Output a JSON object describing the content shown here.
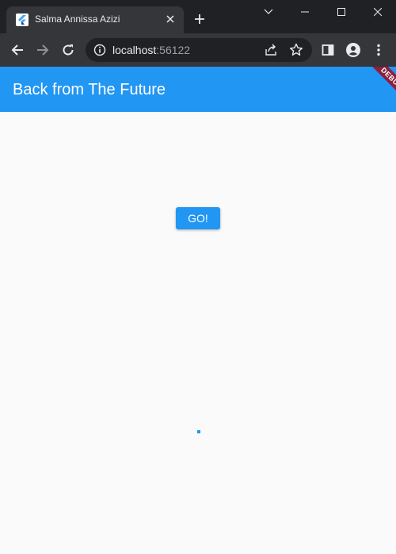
{
  "browser": {
    "tab_title": "Salma Annissa Azizi",
    "url_host": "localhost",
    "url_port": ":56122"
  },
  "app": {
    "title": "Back from The Future",
    "debug_label": "DEBUG",
    "go_button_label": "GO!",
    "accent_color": "#2196f3",
    "debug_banner_color": "#8b1f3f"
  },
  "icons": {
    "favicon": "flutter-icon",
    "tab_close": "close-icon",
    "new_tab": "plus-icon",
    "back": "arrow-left-icon",
    "forward": "arrow-right-icon",
    "reload": "reload-icon",
    "site_info": "info-icon",
    "share": "share-icon",
    "bookmark": "star-icon",
    "side_panel": "side-panel-icon",
    "profile": "profile-icon",
    "menu": "kebab-menu-icon"
  }
}
